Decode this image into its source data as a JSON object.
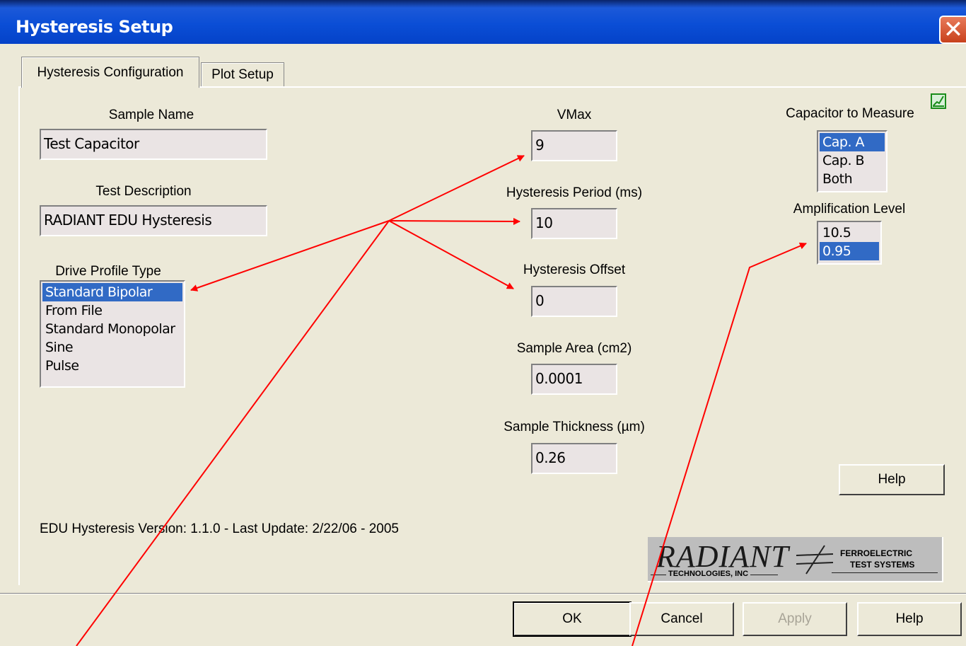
{
  "window": {
    "title": "Hysteresis Setup"
  },
  "tabs": [
    {
      "label": "Hysteresis Configuration"
    },
    {
      "label": "Plot Setup"
    }
  ],
  "sample_name": {
    "label": "Sample Name",
    "value": "Test Capacitor"
  },
  "test_description": {
    "label": "Test Description",
    "value": "RADIANT EDU Hysteresis"
  },
  "drive_profile": {
    "label": "Drive Profile Type",
    "options": [
      "Standard Bipolar",
      "From File",
      "Standard Monopolar",
      "Sine",
      "Pulse"
    ],
    "selected": "Standard Bipolar"
  },
  "vmax": {
    "label": "VMax",
    "value": "9"
  },
  "hysteresis_period": {
    "label": "Hysteresis Period (ms)",
    "value": "10"
  },
  "hysteresis_offset": {
    "label": "Hysteresis Offset",
    "value": "0"
  },
  "sample_area": {
    "label": "Sample Area (cm2)",
    "value": "0.0001"
  },
  "sample_thickness": {
    "label": "Sample Thickness (µm)",
    "value": "0.26"
  },
  "capacitor": {
    "label": "Capacitor to Measure",
    "options": [
      "Cap. A",
      "Cap. B",
      "Both"
    ],
    "selected": "Cap. A"
  },
  "amplification": {
    "label": "Amplification Level",
    "options": [
      "10.5",
      "0.95"
    ],
    "selected": "0.95"
  },
  "help_inner": "Help",
  "version_text": "EDU Hysteresis Version: 1.1.0 - Last Update: 2/22/06 - 2005",
  "logo": {
    "brand": "RADIANT",
    "sub": "TECHNOLOGIES, INC",
    "right_line1": "FERROELECTRIC",
    "right_line2": "TEST SYSTEMS"
  },
  "footer_buttons": {
    "ok": "OK",
    "cancel": "Cancel",
    "apply": "Apply",
    "help": "Help"
  },
  "colors": {
    "annotation": "#ff0000",
    "selection": "#316ac5",
    "title_bar": "#0b4ed6"
  }
}
